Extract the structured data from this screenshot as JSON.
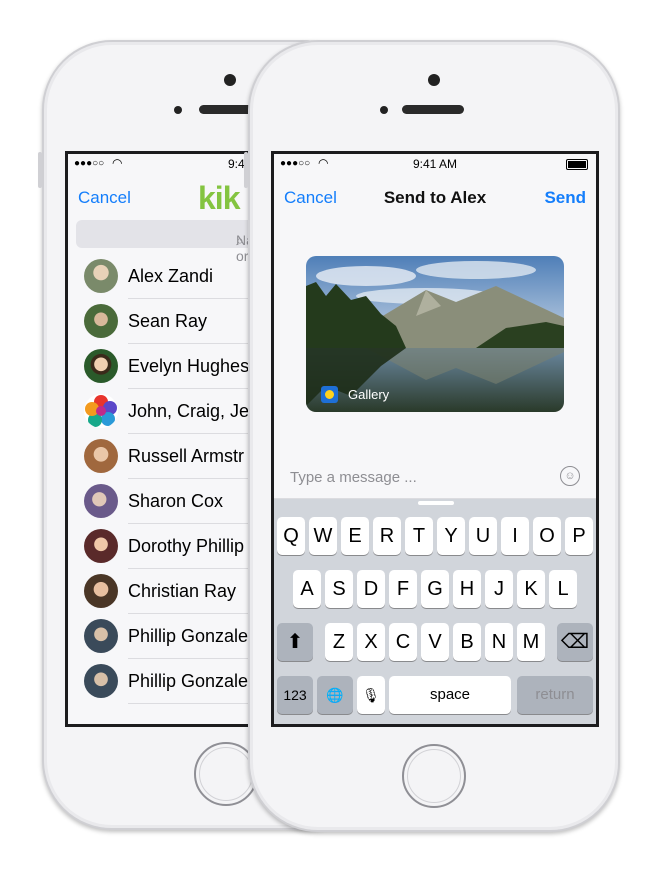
{
  "left_phone": {
    "status": {
      "signal": "●●●○○",
      "wifi": "◠",
      "time": "9:41 A"
    },
    "nav": {
      "cancel_label": "Cancel",
      "logo_text": "kik"
    },
    "search": {
      "placeholder": "Name or U"
    },
    "contacts": [
      {
        "name": "Alex Zandi",
        "color": "#7a8a6a"
      },
      {
        "name": "Sean Ray",
        "color": "#5a7a4a"
      },
      {
        "name": "Evelyn Hughes",
        "color": "#3a6a3a"
      },
      {
        "name": "John, Craig, Je",
        "color": "#e0403a"
      },
      {
        "name": "Russell Armstr",
        "color": "#a06a4a"
      },
      {
        "name": "Sharon Cox",
        "color": "#8a7aa0"
      },
      {
        "name": "Dorothy Phillip",
        "color": "#7a4a5a"
      },
      {
        "name": "Christian Ray",
        "color": "#5a4a3a"
      },
      {
        "name": "Phillip Gonzale",
        "color": "#4a5a6a"
      },
      {
        "name": "Phillip Gonzale",
        "color": "#4a5a6a"
      }
    ]
  },
  "right_phone": {
    "status": {
      "signal": "●●●○○",
      "wifi": "◠",
      "time": "9:41 AM"
    },
    "nav": {
      "cancel_label": "Cancel",
      "title": "Send to Alex",
      "send_label": "Send"
    },
    "card": {
      "label": "Gallery"
    },
    "message": {
      "placeholder": "Type a message ...",
      "emoji_icon": "☺"
    },
    "keyboard": {
      "row1": [
        "Q",
        "W",
        "E",
        "R",
        "T",
        "Y",
        "U",
        "I",
        "O",
        "P"
      ],
      "row2": [
        "A",
        "S",
        "D",
        "F",
        "G",
        "H",
        "J",
        "K",
        "L"
      ],
      "row3": [
        "Z",
        "X",
        "C",
        "V",
        "B",
        "N",
        "M"
      ],
      "shift_icon": "⬆",
      "delete_icon": "⌫",
      "numbers_label": "123",
      "globe_icon": "🌐",
      "mic_icon": "🎙",
      "space_label": "space",
      "return_label": "return"
    }
  },
  "colors": {
    "accent": "#147efb",
    "kik_green": "#84c441"
  }
}
